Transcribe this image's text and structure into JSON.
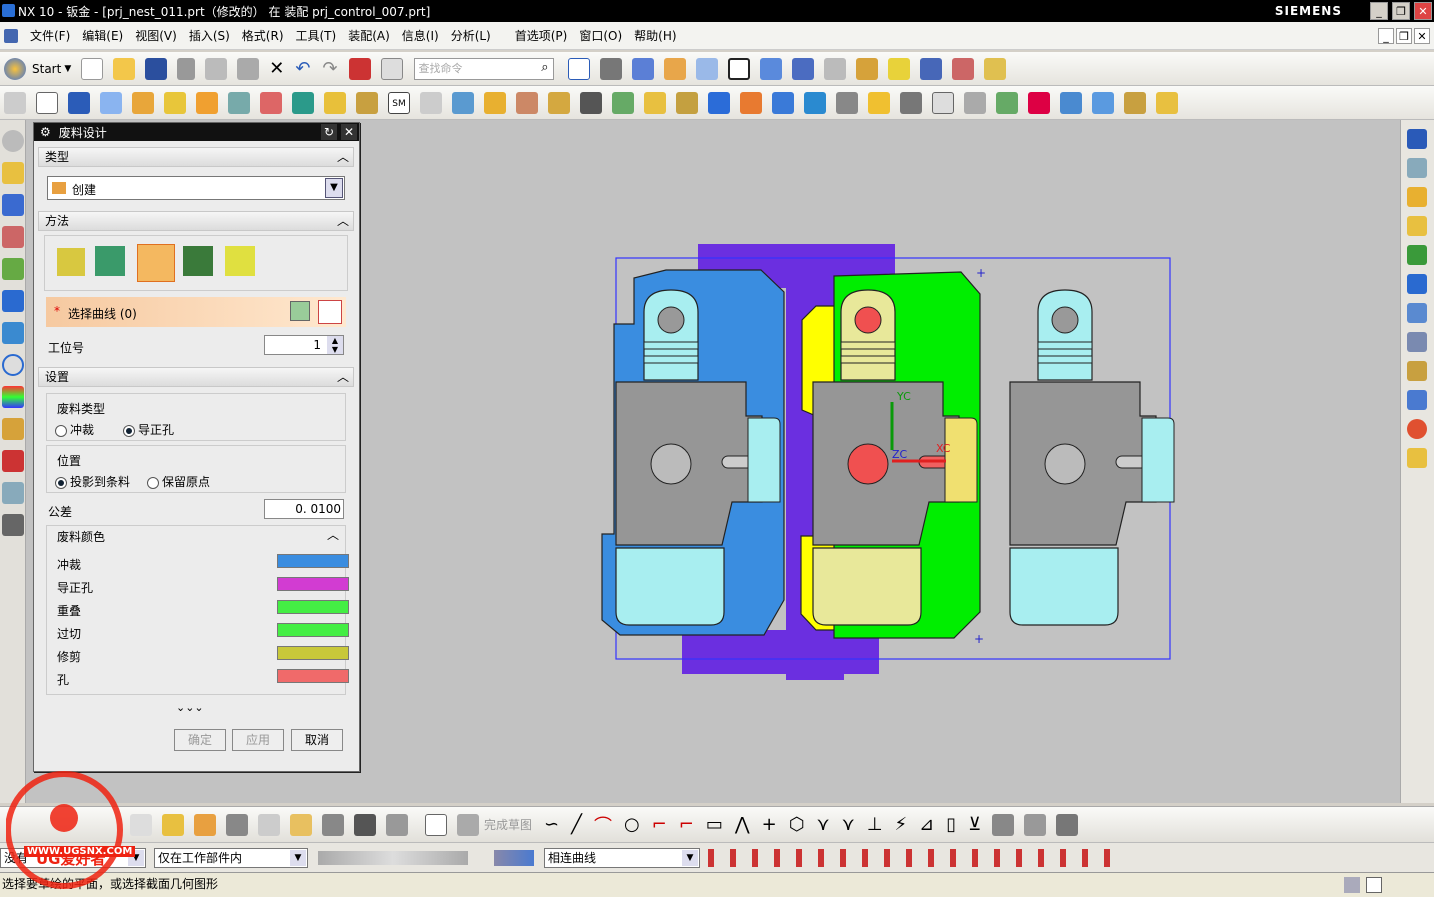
{
  "window": {
    "title": "NX 10 - 钣金 - [prj_nest_011.prt（修改的） 在 装配 prj_control_007.prt]",
    "brand": "SIEMENS"
  },
  "menu": [
    "文件(F)",
    "编辑(E)",
    "视图(V)",
    "插入(S)",
    "格式(R)",
    "工具(T)",
    "装配(A)",
    "信息(I)",
    "分析(L)",
    "首选项(P)",
    "窗口(O)",
    "帮助(H)"
  ],
  "toolbar": {
    "start_label": "Start",
    "search_placeholder": "查找命令",
    "sm_label": "SM"
  },
  "dialog": {
    "title": "废料设计",
    "section_type": "类型",
    "type_value": "创建",
    "section_method": "方法",
    "select_curve": "选择曲线 (0)",
    "station_label": "工位号",
    "station_value": "1",
    "section_settings": "设置",
    "scrap_type_label": "废料类型",
    "scrap_type_options": [
      "冲裁",
      "导正孔"
    ],
    "scrap_type_selected": "导正孔",
    "position_label": "位置",
    "position_options": [
      "投影到条料",
      "保留原点"
    ],
    "position_selected": "投影到条料",
    "tolerance_label": "公差",
    "tolerance_value": "0. 0100",
    "color_section": "废料颜色",
    "colors": [
      {
        "label": "冲裁",
        "color": "#3a8de0"
      },
      {
        "label": "导正孔",
        "color": "#d23cd2"
      },
      {
        "label": "重叠",
        "color": "#44ee44"
      },
      {
        "label": "过切",
        "color": "#44ee44"
      },
      {
        "label": "修剪",
        "color": "#c8c83a"
      },
      {
        "label": "孔",
        "color": "#f06a6a"
      }
    ],
    "ok": "确定",
    "apply": "应用",
    "cancel": "取消"
  },
  "bottom_toolbar": {
    "finish_sketch": "完成草图"
  },
  "selection_bar": {
    "filter_value": "仅在工作部件内",
    "curve_rule": "相连曲线",
    "left_value": "没有"
  },
  "viewport": {
    "axis_yc": "YC",
    "axis_xc": "XC",
    "axis_zc": "ZC"
  },
  "status": {
    "message": "选择要草绘的平面，或选择截面几何图形"
  },
  "watermark": {
    "text": "UG爱好者",
    "url": "WWW.UGSNX.COM"
  }
}
